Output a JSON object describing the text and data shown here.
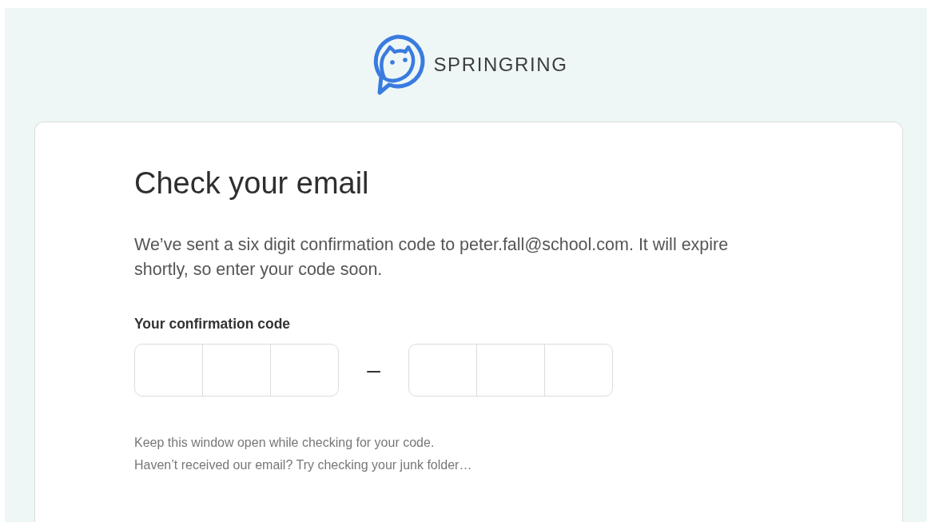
{
  "logo": {
    "text": "SPRINGRING"
  },
  "card": {
    "title": "Check your email",
    "message": "We’ve sent a six digit confirmation code to peter.fall@school.com. It will expire shortly, so enter your code soon.",
    "code_label": "Your confirmation code",
    "code_parts": [
      {
        "kind": "group",
        "digits": [
          {
            "kind": "digit"
          },
          {
            "kind": "digit"
          },
          {
            "kind": "digit"
          }
        ]
      },
      {
        "kind": "separator",
        "text": "–"
      },
      {
        "kind": "group",
        "digits": [
          {
            "kind": "digit"
          },
          {
            "kind": "digit"
          },
          {
            "kind": "digit"
          }
        ]
      }
    ],
    "notes": [
      "Keep this window open while checking for your code.",
      "Haven’t received our email? Try checking your junk folder…"
    ]
  }
}
